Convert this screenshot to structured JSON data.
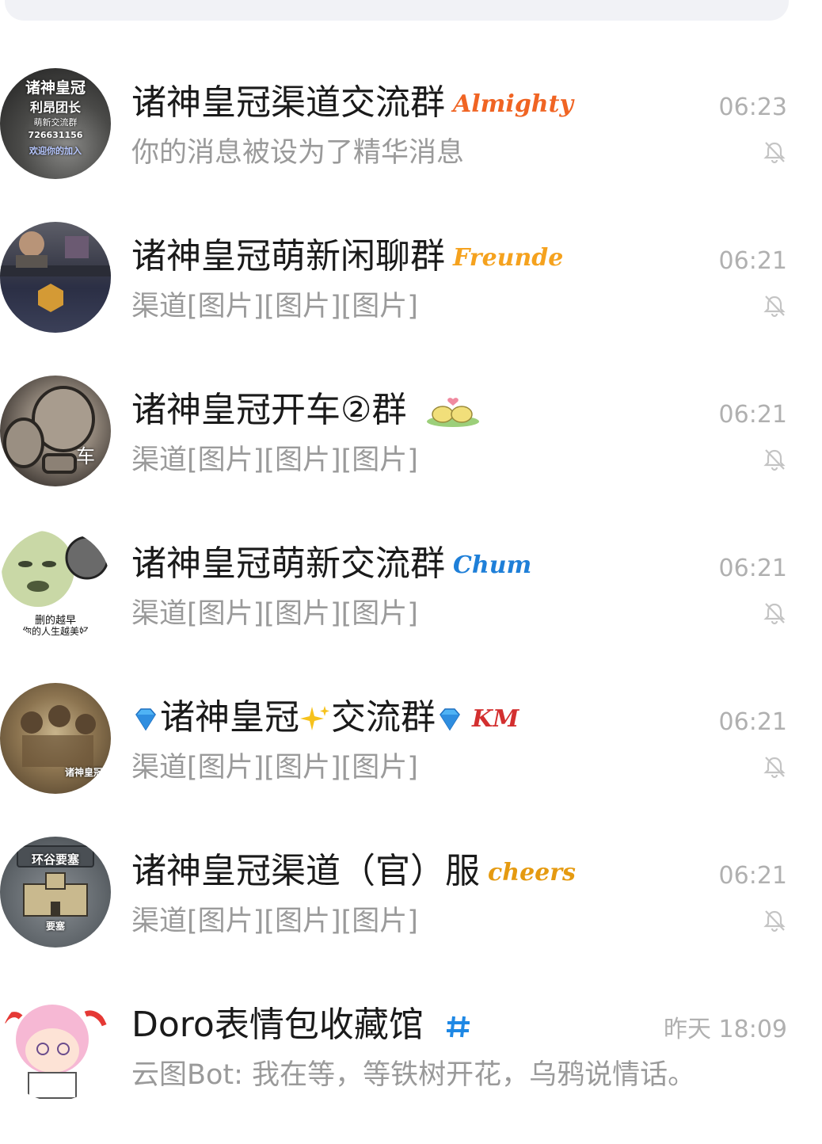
{
  "chats": [
    {
      "title": "诸神皇冠渠道交流群",
      "badge": "Almighty",
      "badge_color": "#f06423",
      "preview": "你的消息被设为了精华消息",
      "time": "06:23",
      "muted": true,
      "avatar_lines": [
        "诸神皇冠",
        "利昂团长",
        "萌新交流群",
        "726631156",
        "欢迎你的加入"
      ]
    },
    {
      "title": "诸神皇冠萌新闲聊群",
      "badge": "Freunde",
      "badge_color": "#f5a21e",
      "preview": "渠道[图片][图片][图片]",
      "time": "06:21",
      "muted": true
    },
    {
      "title": "诸神皇冠开车②群",
      "badge_icon": "frog-pair-sticker",
      "preview": "渠道[图片][图片][图片]",
      "time": "06:21",
      "muted": true,
      "avatar_lines": [
        "车"
      ]
    },
    {
      "title": "诸神皇冠萌新交流群",
      "badge": "Chum",
      "badge_color": "#1e7fd8",
      "preview": "渠道[图片][图片][图片]",
      "time": "06:21",
      "muted": true,
      "avatar_lines": [
        "删的越早",
        "你的人生越美好"
      ]
    },
    {
      "title_parts": [
        "诸神皇冠",
        "交流群"
      ],
      "title_icons": [
        "diamond-emoji",
        "sparkles-emoji",
        "diamond-emoji"
      ],
      "badge": "KM",
      "badge_color": "#d32f2f",
      "preview": "渠道[图片][图片][图片]",
      "time": "06:21",
      "muted": true,
      "avatar_lines": [
        "诸神皇冠"
      ]
    },
    {
      "title": "诸神皇冠渠道（官）服",
      "badge": "cheers",
      "badge_color": "#e59a10",
      "preview": "渠道[图片][图片][图片]",
      "time": "06:21",
      "muted": true,
      "avatar_lines": [
        "环谷要塞",
        "要塞"
      ]
    },
    {
      "title": "Doro表情包收藏馆",
      "badge_icon": "hashtag-icon",
      "badge_color": "#1e88e5",
      "preview": "云图Bot: 我在等，等铁树开花，乌鸦说情话。",
      "time": "昨天 18:09",
      "muted": false
    }
  ]
}
